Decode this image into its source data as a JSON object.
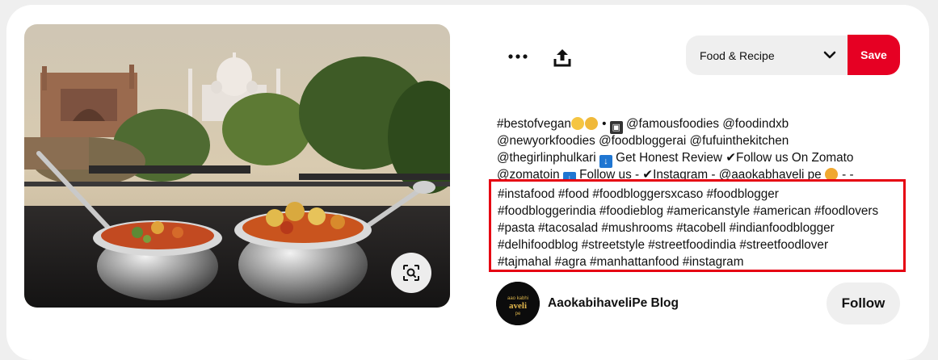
{
  "pin": {
    "image_alt": "Two steel bowls of vegetable curry on a rooftop table with the Taj Mahal in the background",
    "lens_icon": "visual-search-icon"
  },
  "toolbar": {
    "more_icon": "more-dots-icon",
    "share_icon": "share-upload-icon",
    "board_label": "Food & Recipe",
    "board_chevron_icon": "chevron-down-icon",
    "save_label": "Save"
  },
  "description": {
    "line1_a": "#bestofvegan",
    "line1_b": " • ",
    "line1_c": " @famousfoodies @foodindxb",
    "line2": "@newyorkfoodies @foodbloggerai @fufuinthekitchen",
    "line3_a": "@thegirlinphulkari ",
    "line3_b": " Get Honest Review ✔Follow us On Zomato",
    "line4_a": "@zomatoin ",
    "line4_b": " Follow us - ✔Instagram - @aaokabhaveli pe ",
    "line4_c": " - -"
  },
  "hashtags": [
    "#instafood #food #foodbloggersxcaso #foodblogger",
    "#foodbloggerindia #foodieblog #americanstyle #american #foodlovers",
    "#pasta #tacosalad #mushrooms #tacobell #indianfoodblogger",
    "#delhifoodblog #streetstyle #streetfoodindia #streetfoodlover",
    "#tajmahal #agra #manhattanfood #instagram"
  ],
  "creator": {
    "name": "AaokabihaveliPe Blog",
    "avatar_text": "Aao kabhi haveli pe",
    "follow_label": "Follow"
  },
  "colors": {
    "save_red": "#e60023",
    "highlight_border": "#e60012",
    "pill_gray": "#efefef"
  }
}
